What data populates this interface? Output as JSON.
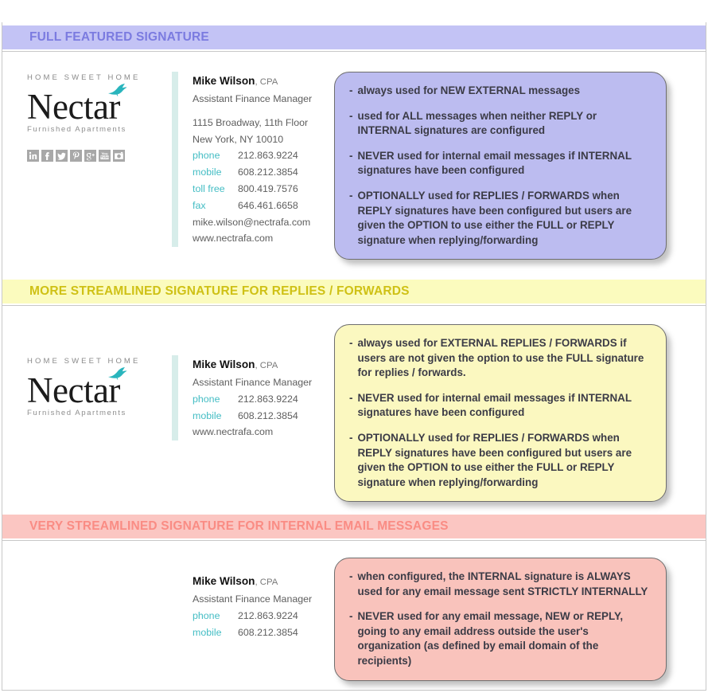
{
  "sections": [
    {
      "id": "full",
      "band_label": "FULL FEATURED SIGNATURE",
      "band_bg": "#c3c3f5",
      "band_color": "#7b7be0",
      "callout_bg": "#bcbcf0",
      "signature": {
        "tagline": "HOME SWEET HOME",
        "logo_name": "Nectar",
        "logo_tagline": "Furnished Apartments",
        "name": "Mike Wilson",
        "credential": ", CPA",
        "title": "Assistant Finance Manager",
        "address_line1": "1115 Broadway, 11th Floor",
        "address_line2": "New York, NY 10010",
        "phone_label": "phone",
        "phone_value": "212.863.9224",
        "mobile_label": "mobile",
        "mobile_value": "608.212.3854",
        "tollfree_label": "toll free",
        "tollfree_value": "800.419.7576",
        "fax_label": "fax",
        "fax_value": "646.461.6658",
        "email": "mike.wilson@nectrafa.com",
        "website": "www.nectrafa.com",
        "social": [
          "linkedin-icon",
          "facebook-icon",
          "twitter-icon",
          "pinterest-icon",
          "googleplus-icon",
          "youtube-icon",
          "instagram-icon"
        ]
      },
      "bullets": [
        "always used for NEW EXTERNAL messages",
        "used for ALL messages when neither REPLY or INTERNAL signatures are configured",
        "NEVER used for internal email messages if INTERNAL signatures have been configured",
        "OPTIONALLY used for REPLIES / FORWARDS when REPLY signatures have been configured but users are given the OPTION to use either the FULL or REPLY signature when replying/forwarding"
      ]
    },
    {
      "id": "reply",
      "band_label": "MORE STREAMLINED SIGNATURE FOR REPLIES / FORWARDS",
      "band_bg": "#fbfbbe",
      "band_color": "#cfc116",
      "callout_bg": "#fbf8c0",
      "signature": {
        "tagline": "HOME SWEET HOME",
        "logo_name": "Nectar",
        "logo_tagline": "Furnished Apartments",
        "name": "Mike Wilson",
        "credential": ", CPA",
        "title": "Assistant Finance Manager",
        "phone_label": "phone",
        "phone_value": "212.863.9224",
        "mobile_label": "mobile",
        "mobile_value": "608.212.3854",
        "website": "www.nectrafa.com"
      },
      "bullets": [
        "always used for EXTERNAL REPLIES / FORWARDS if users are not given the option to use the FULL signature for replies / forwards.",
        "NEVER used for internal email messages if INTERNAL signatures have been configured",
        "OPTIONALLY used for REPLIES / FORWARDS when REPLY signatures have been configured but users are given the OPTION to use either the FULL or REPLY signature when replying/forwarding"
      ]
    },
    {
      "id": "internal",
      "band_label": "VERY STREAMLINED SIGNATURE FOR INTERNAL EMAIL MESSAGES",
      "band_bg": "#fbc6c2",
      "band_color": "#fa8c84",
      "callout_bg": "#f9c3bc",
      "signature": {
        "name": "Mike Wilson",
        "credential": ", CPA",
        "title": "Assistant Finance Manager",
        "phone_label": "phone",
        "phone_value": "212.863.9224",
        "mobile_label": "mobile",
        "mobile_value": "608.212.3854"
      },
      "bullets": [
        "when configured, the INTERNAL signature is ALWAYS used for any email message sent STRICTLY INTERNALLY",
        "NEVER used for any email message, NEW or REPLY, going to any email address outside the user's organization (as defined by email domain of the recipients)"
      ]
    }
  ],
  "bullet_dash": "-",
  "accent_colors": {
    "label_teal": "#44bdc4",
    "divider_mint": "#d7edea",
    "bird_teal": "#29b5bd"
  }
}
